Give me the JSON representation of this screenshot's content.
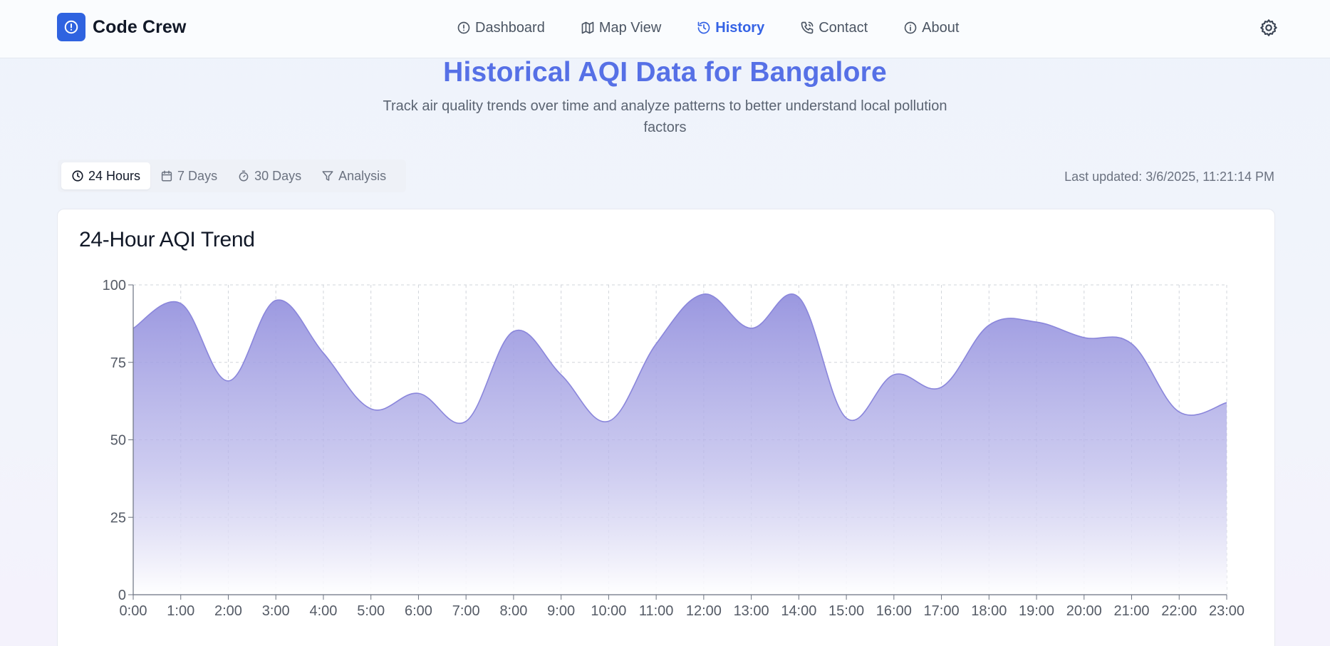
{
  "header": {
    "brand": "Code Crew",
    "nav": [
      {
        "label": "Dashboard",
        "icon": "alert-circle-icon"
      },
      {
        "label": "Map View",
        "icon": "map-icon"
      },
      {
        "label": "History",
        "icon": "history-icon",
        "active": true
      },
      {
        "label": "Contact",
        "icon": "phone-icon"
      },
      {
        "label": "About",
        "icon": "info-icon"
      }
    ],
    "settings_icon": "gear-icon"
  },
  "hero": {
    "title": "Historical AQI Data for Bangalore",
    "subtitle": "Track air quality trends over time and analyze patterns to better understand local pollution factors"
  },
  "tabs": [
    {
      "label": "24 Hours",
      "icon": "clock-icon",
      "active": true
    },
    {
      "label": "7 Days",
      "icon": "calendar-icon"
    },
    {
      "label": "30 Days",
      "icon": "timer-icon"
    },
    {
      "label": "Analysis",
      "icon": "filter-icon"
    }
  ],
  "last_updated": "Last updated: 3/6/2025, 11:21:14 PM",
  "card": {
    "title": "24-Hour AQI Trend"
  },
  "colors": {
    "accent": "#3563e5",
    "title": "#5670e6",
    "series_stroke": "#8a86db",
    "series_fill": "#9a97e0"
  },
  "chart_data": {
    "type": "area",
    "title": "24-Hour AQI Trend",
    "xlabel": "",
    "ylabel": "",
    "categories": [
      "0:00",
      "1:00",
      "2:00",
      "3:00",
      "4:00",
      "5:00",
      "6:00",
      "7:00",
      "8:00",
      "9:00",
      "10:00",
      "11:00",
      "12:00",
      "13:00",
      "14:00",
      "15:00",
      "16:00",
      "17:00",
      "18:00",
      "19:00",
      "20:00",
      "21:00",
      "22:00",
      "23:00"
    ],
    "values": [
      86,
      94,
      69,
      95,
      78,
      60,
      65,
      56,
      85,
      71,
      56,
      81,
      97,
      86,
      96,
      57,
      71,
      67,
      87,
      88,
      83,
      81,
      59,
      62
    ],
    "ylim": [
      0,
      100
    ],
    "yticks": [
      0,
      25,
      50,
      75,
      100
    ],
    "grid": true,
    "legend": "none"
  }
}
